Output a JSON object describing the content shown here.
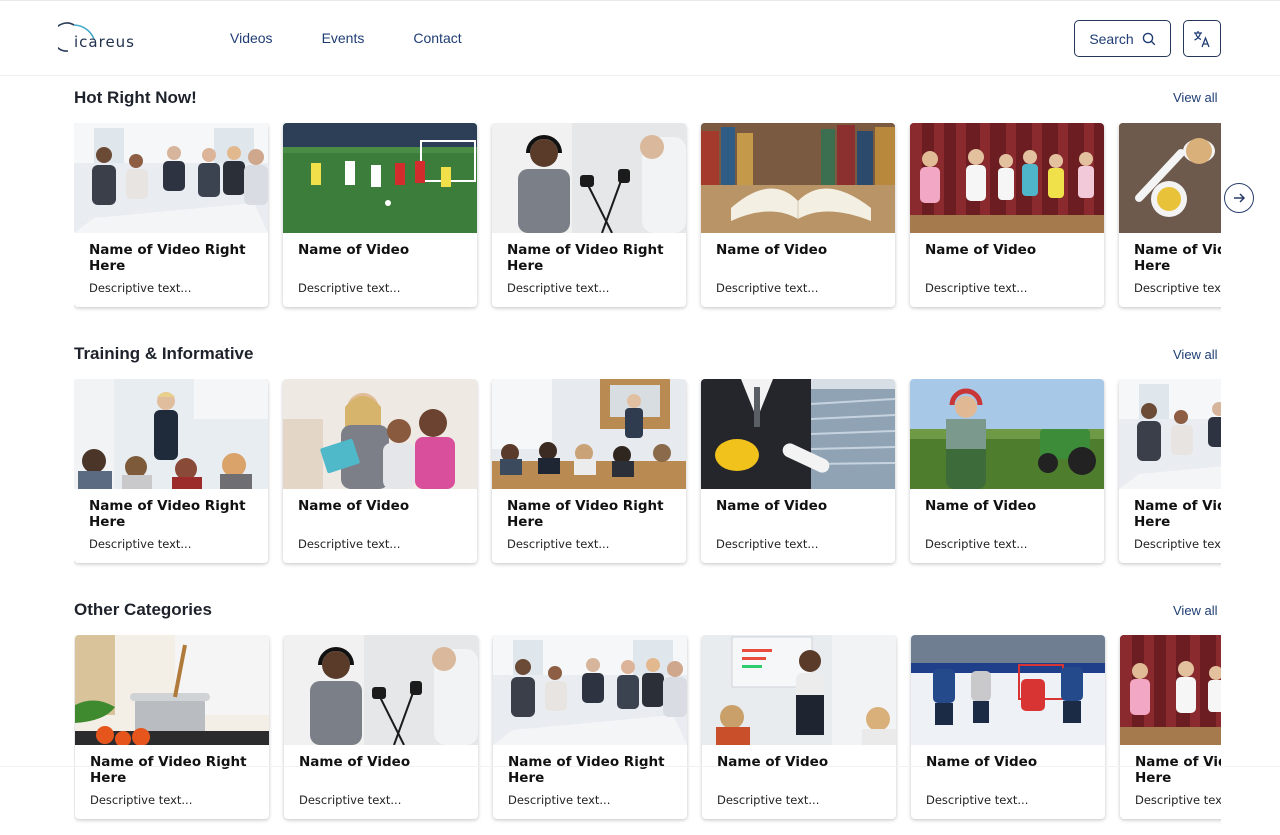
{
  "header": {
    "logo_text": "icareus",
    "nav": [
      "Videos",
      "Events",
      "Contact"
    ],
    "search_label": "Search"
  },
  "sections": [
    {
      "title": "Hot Right Now!",
      "view_all": "View all",
      "cards": [
        {
          "title": "Name of Video Right Here",
          "desc": "Descriptive text...",
          "scene": "meeting"
        },
        {
          "title": "Name of Video",
          "desc": "Descriptive text...",
          "scene": "soccer"
        },
        {
          "title": "Name of Video Right Here",
          "desc": "Descriptive text...",
          "scene": "podcast"
        },
        {
          "title": "Name of Video",
          "desc": "Descriptive text...",
          "scene": "book"
        },
        {
          "title": "Name of Video",
          "desc": "Descriptive text...",
          "scene": "kids"
        },
        {
          "title": "Name of Video Right Here",
          "desc": "Descriptive text...",
          "scene": "food"
        }
      ]
    },
    {
      "title": "Training & Informative",
      "view_all": "View all",
      "cards": [
        {
          "title": "Name of Video Right Here",
          "desc": "Descriptive text...",
          "scene": "lecture"
        },
        {
          "title": "Name of Video",
          "desc": "Descriptive text...",
          "scene": "tutor"
        },
        {
          "title": "Name of Video Right Here",
          "desc": "Descriptive text...",
          "scene": "classroom"
        },
        {
          "title": "Name of Video",
          "desc": "Descriptive text...",
          "scene": "business"
        },
        {
          "title": "Name of Video",
          "desc": "Descriptive text...",
          "scene": "farmer"
        },
        {
          "title": "Name of Video Right Here",
          "desc": "Descriptive text...",
          "scene": "meeting"
        }
      ]
    },
    {
      "title": "Other Categories",
      "view_all": "View all",
      "cards": [
        {
          "title": "Name of Video Right Here",
          "desc": "Descriptive text...",
          "scene": "cooking"
        },
        {
          "title": "Name of Video",
          "desc": "Descriptive text...",
          "scene": "podcast"
        },
        {
          "title": "Name of Video Right Here",
          "desc": "Descriptive text...",
          "scene": "meeting"
        },
        {
          "title": "Name of Video",
          "desc": "Descriptive text...",
          "scene": "presenter"
        },
        {
          "title": "Name of Video",
          "desc": "Descriptive text...",
          "scene": "hockey"
        },
        {
          "title": "Name of Video Right Here",
          "desc": "Descriptive text...",
          "scene": "kids"
        }
      ]
    }
  ],
  "icons": {
    "search": "search-icon",
    "language": "translate-icon",
    "next": "arrow-right-circle-icon"
  }
}
